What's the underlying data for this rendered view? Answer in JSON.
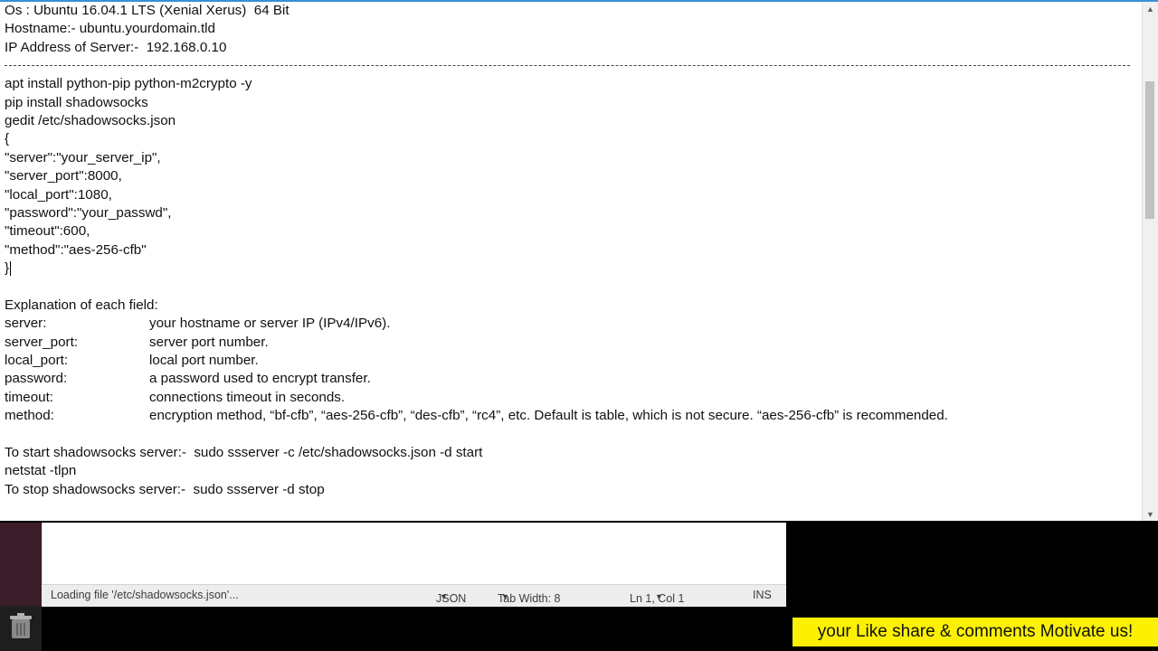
{
  "document": {
    "header_lines": [
      "Os : Ubuntu 16.04.1 LTS (Xenial Xerus)  64 Bit",
      "Hostname:- ubuntu.yourdomain.tld",
      "IP Address of Server:-  192.168.0.10"
    ],
    "command_lines": [
      "apt install python-pip python-m2crypto -y",
      "pip install shadowsocks",
      "gedit /etc/shadowsocks.json",
      "{",
      "\"server\":\"your_server_ip\",",
      "\"server_port\":8000,",
      "\"local_port\":1080,",
      "\"password\":\"your_passwd\",",
      "\"timeout\":600,",
      "\"method\":\"aes-256-cfb\"",
      "}"
    ],
    "explanation_title": "Explanation of each field:",
    "fields": [
      {
        "key": "server:",
        "desc": "your hostname or server IP (IPv4/IPv6)."
      },
      {
        "key": "server_port:",
        "desc": "server port number."
      },
      {
        "key": "local_port:",
        "desc": "local port number."
      },
      {
        "key": "password:",
        "desc": "a password used to encrypt transfer."
      },
      {
        "key": "timeout:",
        "desc": "connections timeout in seconds."
      },
      {
        "key": "method:",
        "desc": "encryption method, “bf-cfb”, “aes-256-cfb”, “des-cfb”, “rc4”, etc. Default is table, which is not secure. “aes-256-cfb” is recommended."
      }
    ],
    "start_line": "To start shadowsocks server:-  sudo ssserver -c /etc/shadowsocks.json -d start",
    "netstat_line": "netstat -tlpn",
    "stop_line": "To stop shadowsocks server:-  sudo ssserver -d stop"
  },
  "gedit": {
    "status_text": "Loading file '/etc/shadowsocks.json'...",
    "language": "JSON",
    "tab_width": "Tab Width: 8",
    "position": "Ln 1, Col 1",
    "mode": "INS"
  },
  "banner_text": "your Like share & comments Motivate us!",
  "icons": [
    "scroll-up-icon",
    "scroll-down-icon",
    "chevron-down-icon",
    "trash-icon"
  ]
}
